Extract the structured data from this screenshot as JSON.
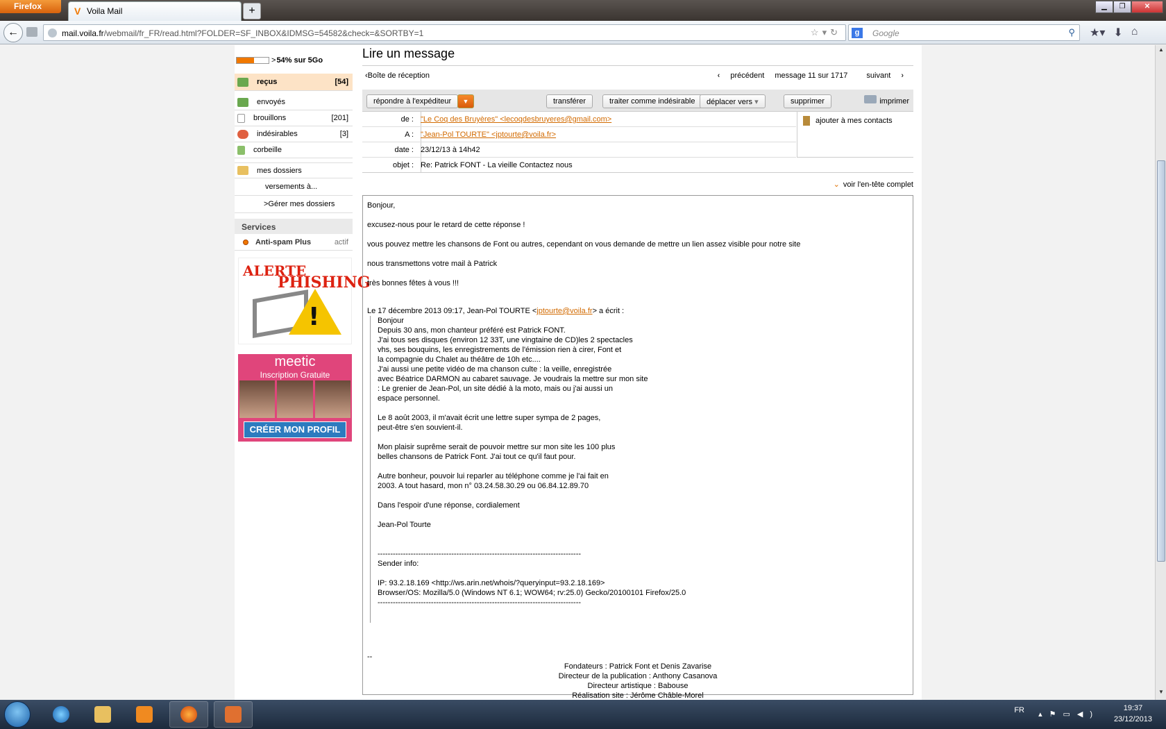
{
  "browser": {
    "app_button": "Firefox",
    "tab_title": "Voila Mail",
    "new_tab": "+",
    "url_domain": "mail.voila.fr",
    "url_path": "/webmail/fr_FR/read.html?FOLDER=SF_INBOX&IDMSG=54582&check=&SORTBY=1",
    "search_placeholder": "Google"
  },
  "sidebar": {
    "quota_percent": 54,
    "quota_text": "54% sur 5Go",
    "quota_prefix": ">",
    "folders": [
      {
        "label": "reçus",
        "count": "[54]",
        "active": true
      },
      {
        "label": "envoyés",
        "count": ""
      },
      {
        "label": "brouillons",
        "count": "[201]"
      },
      {
        "label": "indésirables",
        "count": "[3]"
      },
      {
        "label": "corbeille",
        "count": ""
      },
      {
        "label": "mes dossiers",
        "count": ""
      }
    ],
    "subfolders": [
      "versements à...",
      ">Gérer mes dossiers"
    ],
    "services_title": "Services",
    "antispam_label": "Anti-spam Plus",
    "antispam_status": "actif"
  },
  "ads": {
    "phishing_line1": "ALERTE",
    "phishing_line2": "PHISHING",
    "meetic_logo": "meetic",
    "meetic_sub": "Inscription Gratuite",
    "meetic_cta": "CRÉER MON PROFIL"
  },
  "main": {
    "title": "Lire un message",
    "back_label": "Boîte de réception",
    "prev_label": "précédent",
    "position": "message 11 sur 1717",
    "next_label": "suivant",
    "toolbar": {
      "reply": "répondre à l'expéditeur",
      "forward": "transférer",
      "spam": "traiter comme indésirable",
      "move": "déplacer vers",
      "delete": "supprimer",
      "print": "imprimer"
    },
    "headers": {
      "from_label": "de :",
      "from_value": "\"Le Coq des Bruyères\" <lecoqdesbruyeres@gmail.com>",
      "to_label": "A :",
      "to_value": "\"Jean-Pol TOURTE\" <jptourte@voila.fr>",
      "date_label": "date :",
      "date_value": "23/12/13 à 14h42",
      "subject_label": "objet :",
      "subject_value": "Re: Patrick FONT - La vieille Contactez nous",
      "add_contact": "ajouter à mes contacts"
    },
    "full_header": "voir l'en-tête complet"
  },
  "message": {
    "greeting": "Bonjour,",
    "p1": "excusez-nous pour le retard de cette réponse !",
    "p2": "vous pouvez mettre les chansons de Font ou autres, cependant on vous demande de mettre un lien assez visible pour notre site",
    "p3": "nous transmettons votre mail à Patrick",
    "p4": "très bonnes fêtes à vous !!!",
    "quote_intro_a": "Le 17 décembre 2013 09:17, Jean-Pol TOURTE <",
    "quote_intro_link": "jptourte@voila.fr",
    "quote_intro_b": "> a écrit :",
    "quote_lines": [
      "Bonjour",
      "Depuis 30 ans, mon chanteur préféré est Patrick FONT.",
      "J'ai tous ses disques (environ 12 33T, une vingtaine de CD)les 2 spectacles",
      "vhs, ses bouquins, les enregistrements de l'émission rien à cirer, Font et",
      "la compagnie du Chalet au théâtre de 10h etc....",
      "J'ai aussi une petite vidéo de ma chanson culte : la veille, enregistrée",
      "avec Béatrice DARMON au cabaret sauvage. Je voudrais la mettre sur mon site",
      ": Le grenier de Jean-Pol, un site dédié à la moto, mais ou j'ai aussi un",
      "espace personnel.",
      "",
      "Le 8 août 2003, il m'avait écrit une lettre super sympa de 2 pages,",
      "peut-être s'en souvient-il.",
      "",
      "Mon plaisir suprême serait de pouvoir mettre sur mon site les 100 plus",
      "belles chansons de Patrick Font. J'ai tout ce qu'il faut pour.",
      "",
      "Autre bonheur, pouvoir lui reparler au téléphone comme je l'ai fait en",
      "2003. A tout hasard, mon n° 03.24.58.30.29 ou 06.84.12.89.70",
      "",
      "Dans l'espoir d'une réponse, cordialement",
      "",
      "Jean-Pol Tourte",
      "",
      "",
      "--------------------------------------------------------------------------------",
      "Sender info:",
      "",
      "IP: 93.2.18.169 <http://ws.arin.net/whois/?queryinput=93.2.18.169>",
      "Browser/OS: Mozilla/5.0 (Windows NT 6.1; WOW64; rv:25.0) Gecko/20100101 Firefox/25.0",
      "--------------------------------------------------------------------------------"
    ],
    "sig_sep": "--",
    "footer_lines": [
      "Fondateurs : Patrick Font et Denis Zavarise",
      "Directeur de la publication : Anthony Casanova",
      "Directeur artistique : Babouse",
      "Réalisation site : Jérôme Châble-Morel"
    ]
  },
  "taskbar": {
    "lang": "FR",
    "time": "19:37",
    "date": "23/12/2013"
  }
}
